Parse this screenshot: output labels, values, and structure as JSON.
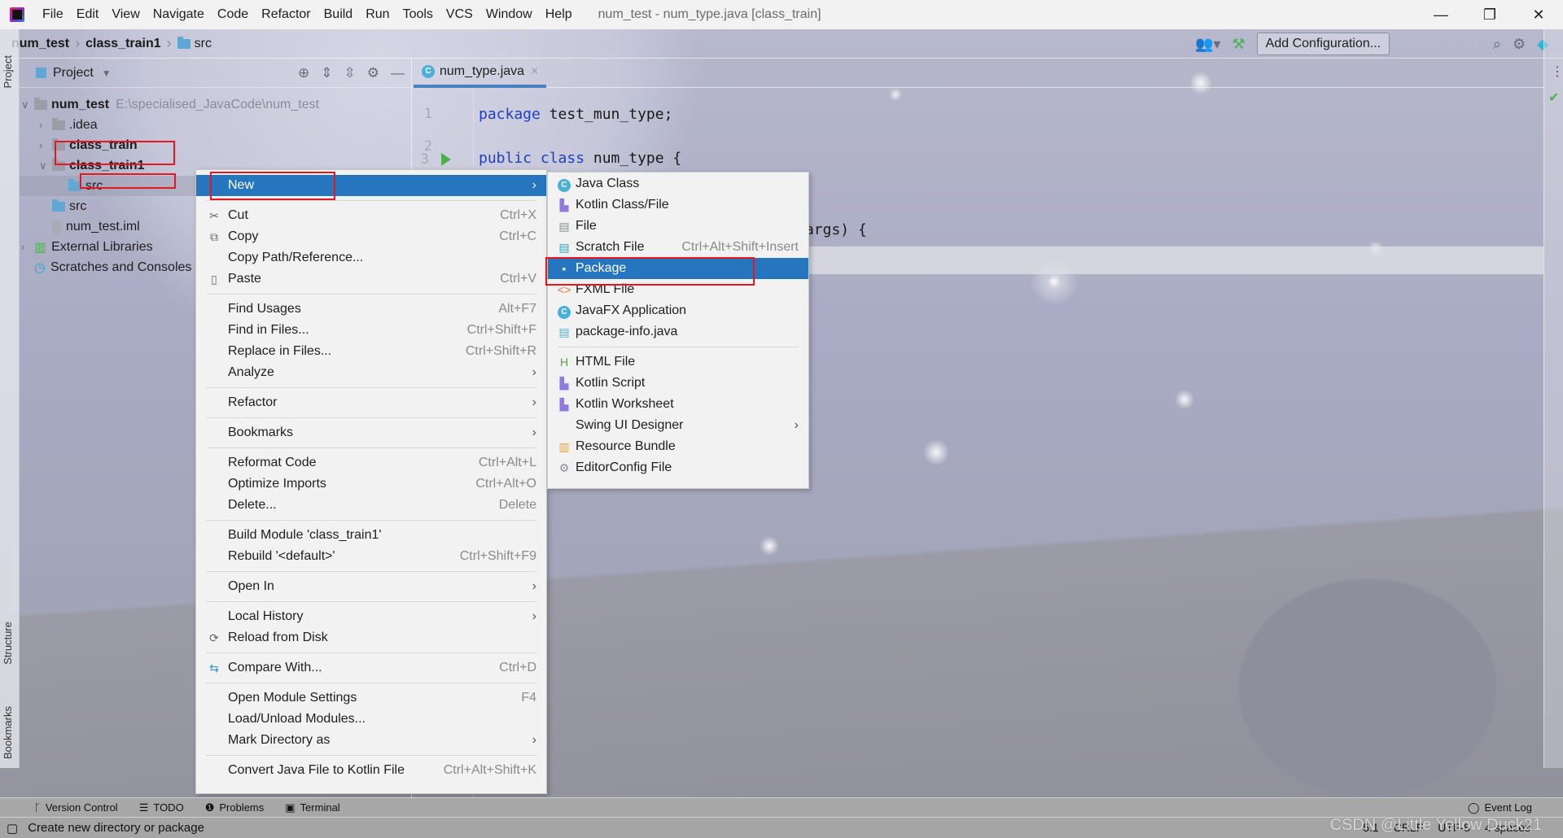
{
  "titlebar": {
    "menus": [
      "File",
      "Edit",
      "View",
      "Navigate",
      "Code",
      "Refactor",
      "Build",
      "Run",
      "Tools",
      "VCS",
      "Window",
      "Help"
    ],
    "window_title": "num_test - num_type.java [class_train]",
    "minimize": "—",
    "restore": "❐",
    "close": "✕"
  },
  "navbar": {
    "breadcrumbs": [
      "num_test",
      "class_train1",
      "src"
    ],
    "add_configuration": "Add Configuration..."
  },
  "side_tabs": {
    "project": "Project",
    "structure": "Structure",
    "bookmarks": "Bookmarks"
  },
  "project_panel": {
    "title": "Project",
    "tree": [
      {
        "label": "num_test",
        "path": "E:\\specialised_JavaCode\\num_test",
        "bold": true
      },
      {
        "label": ".idea"
      },
      {
        "label": "class_train",
        "bold": true
      },
      {
        "label": "class_train1",
        "bold": true
      },
      {
        "label": "src",
        "selected": true
      },
      {
        "label": "src"
      },
      {
        "label": "num_test.iml"
      },
      {
        "label": "External Libraries"
      },
      {
        "label": "Scratches and Consoles"
      }
    ]
  },
  "editor": {
    "tab": "num_type.java",
    "line_numbers": [
      "1",
      "2",
      "3"
    ],
    "lines": [
      {
        "kw": "package",
        "rest": " test_mun_type;"
      },
      {
        "kw": "public class",
        "rest": " num_type {"
      },
      {
        "kw": "",
        "rest": "args) {"
      }
    ]
  },
  "context_menu": [
    {
      "label": "New",
      "submenu": true,
      "highlighted": true
    },
    {
      "sep": true
    },
    {
      "label": "Cut",
      "shortcut": "Ctrl+X",
      "icon": "✂"
    },
    {
      "label": "Copy",
      "shortcut": "Ctrl+C",
      "icon": "⧉"
    },
    {
      "label": "Copy Path/Reference..."
    },
    {
      "label": "Paste",
      "shortcut": "Ctrl+V",
      "icon": "📋"
    },
    {
      "sep": true
    },
    {
      "label": "Find Usages",
      "shortcut": "Alt+F7"
    },
    {
      "label": "Find in Files...",
      "shortcut": "Ctrl+Shift+F"
    },
    {
      "label": "Replace in Files...",
      "shortcut": "Ctrl+Shift+R"
    },
    {
      "label": "Analyze",
      "submenu": true
    },
    {
      "sep": true
    },
    {
      "label": "Refactor",
      "submenu": true
    },
    {
      "sep": true
    },
    {
      "label": "Bookmarks",
      "submenu": true
    },
    {
      "sep": true
    },
    {
      "label": "Reformat Code",
      "shortcut": "Ctrl+Alt+L"
    },
    {
      "label": "Optimize Imports",
      "shortcut": "Ctrl+Alt+O"
    },
    {
      "label": "Delete...",
      "shortcut": "Delete"
    },
    {
      "sep": true
    },
    {
      "label": "Build Module 'class_train1'"
    },
    {
      "label": "Rebuild '<default>'",
      "shortcut": "Ctrl+Shift+F9"
    },
    {
      "sep": true
    },
    {
      "label": "Open In",
      "submenu": true
    },
    {
      "sep": true
    },
    {
      "label": "Local History",
      "submenu": true
    },
    {
      "label": "Reload from Disk",
      "icon": "⟳"
    },
    {
      "sep": true
    },
    {
      "label": "Compare With...",
      "shortcut": "Ctrl+D",
      "icon": "⇆"
    },
    {
      "sep": true
    },
    {
      "label": "Open Module Settings",
      "shortcut": "F4"
    },
    {
      "label": "Load/Unload Modules..."
    },
    {
      "label": "Mark Directory as",
      "submenu": true
    },
    {
      "sep": true
    },
    {
      "label": "Convert Java File to Kotlin File",
      "shortcut": "Ctrl+Alt+Shift+K"
    }
  ],
  "new_submenu": [
    {
      "label": "Java Class",
      "icon": "class"
    },
    {
      "label": "Kotlin Class/File",
      "icon": "kotlin"
    },
    {
      "label": "File",
      "icon": "file"
    },
    {
      "label": "Scratch File",
      "shortcut": "Ctrl+Alt+Shift+Insert",
      "icon": "scratch"
    },
    {
      "label": "Package",
      "icon": "package",
      "highlighted": true
    },
    {
      "label": "FXML File",
      "icon": "fxml"
    },
    {
      "label": "JavaFX Application",
      "icon": "class"
    },
    {
      "label": "package-info.java",
      "icon": "java-file"
    },
    {
      "sep": true
    },
    {
      "label": "HTML File",
      "icon": "html"
    },
    {
      "label": "Kotlin Script",
      "icon": "kotlin"
    },
    {
      "label": "Kotlin Worksheet",
      "icon": "kotlin"
    },
    {
      "label": "Swing UI Designer",
      "submenu": true
    },
    {
      "label": "Resource Bundle",
      "icon": "bundle"
    },
    {
      "label": "EditorConfig File",
      "icon": "gear"
    }
  ],
  "bottom_tools": [
    "Version Control",
    "TODO",
    "Problems",
    "Terminal"
  ],
  "event_log": "Event Log",
  "status": {
    "message": "Create new directory or package",
    "right": [
      "5:1",
      "CRLF",
      "UTF-8",
      "4 spaces"
    ],
    "watermark": "CSDN @Little Yellow Duck21"
  },
  "colors": {
    "highlight": "#2675bf",
    "annotation_box": "#e8171f",
    "keyword": "#1d3fbe"
  }
}
